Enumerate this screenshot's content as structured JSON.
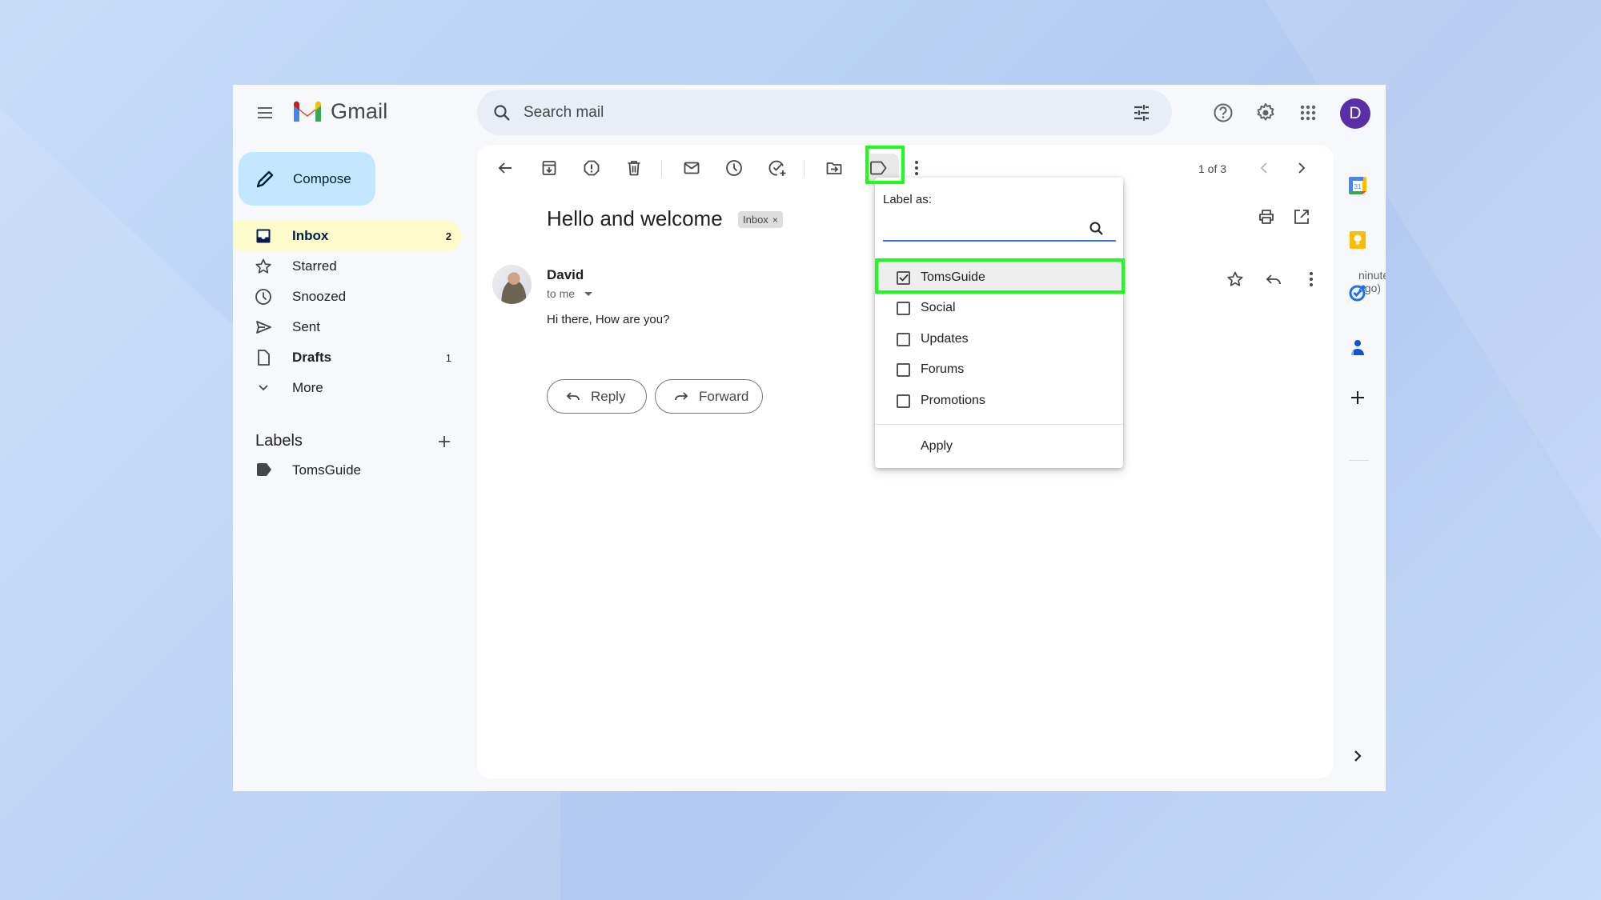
{
  "app": {
    "name": "Gmail",
    "avatar_letter": "D",
    "accent_color": "#1aff1a",
    "avatar_color": "#5a2ea6"
  },
  "header": {
    "search_placeholder": "Search mail",
    "icons": [
      "menu-icon",
      "search-icon",
      "tune-icon",
      "help-icon",
      "settings-icon",
      "apps-icon"
    ]
  },
  "sidebar": {
    "compose_label": "Compose",
    "items": [
      {
        "label": "Inbox",
        "count": "2",
        "icon": "inbox-icon",
        "active": true
      },
      {
        "label": "Starred",
        "count": "",
        "icon": "star-icon"
      },
      {
        "label": "Snoozed",
        "count": "",
        "icon": "clock-icon"
      },
      {
        "label": "Sent",
        "count": "",
        "icon": "send-icon"
      },
      {
        "label": "Drafts",
        "count": "1",
        "icon": "draft-icon"
      },
      {
        "label": "More",
        "count": "",
        "icon": "chevron-down-icon"
      }
    ],
    "labels_heading": "Labels",
    "labels": [
      {
        "label": "TomsGuide",
        "icon": "label-icon"
      }
    ]
  },
  "toolbar": {
    "icons": [
      "back-icon",
      "archive-icon",
      "report-spam-icon",
      "delete-icon",
      "mark-unread-icon",
      "snooze-icon",
      "add-task-icon",
      "move-to-icon",
      "label-icon",
      "more-icon"
    ],
    "pager": "1 of 3"
  },
  "email": {
    "subject": "Hello and welcome",
    "chip_label": "Inbox",
    "chip_close": "×",
    "sender": "David",
    "recipient": "to me",
    "time_text": "ninutes ago)",
    "body": "Hi there, How are you?",
    "reply_label": "Reply",
    "forward_label": "Forward"
  },
  "label_menu": {
    "title": "Label as:",
    "search_value": "",
    "options": [
      {
        "label": "TomsGuide",
        "checked": true
      },
      {
        "label": "Social",
        "checked": false
      },
      {
        "label": "Updates",
        "checked": false
      },
      {
        "label": "Forums",
        "checked": false
      },
      {
        "label": "Promotions",
        "checked": false
      }
    ],
    "apply_label": "Apply"
  },
  "side_rail": {
    "calendar_day": "31",
    "apps": [
      "calendar-icon",
      "keep-icon",
      "tasks-icon",
      "contacts-icon",
      "add-icon",
      "expand-icon"
    ]
  }
}
